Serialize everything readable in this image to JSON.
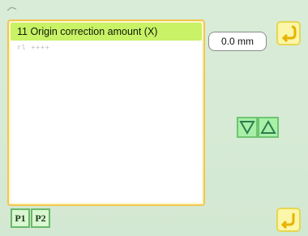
{
  "list": {
    "header": "11 Origin correction amount (X)",
    "sub": "rl ++++"
  },
  "value": {
    "display": "0.0 mm"
  },
  "pages": {
    "p1": "P1",
    "p2": "P2"
  },
  "icons": {
    "top_button": "enter-return-icon",
    "bottom_button": "return-back-icon",
    "down_arrow": "triangle-down-icon",
    "up_arrow": "triangle-up-icon"
  },
  "colors": {
    "background": "#d7ebd6",
    "header_highlight": "#c9f266",
    "panel_border": "#f2c74d",
    "arrow_fill": "#a8f0a8",
    "yellow_button": "#fbf6a8"
  }
}
